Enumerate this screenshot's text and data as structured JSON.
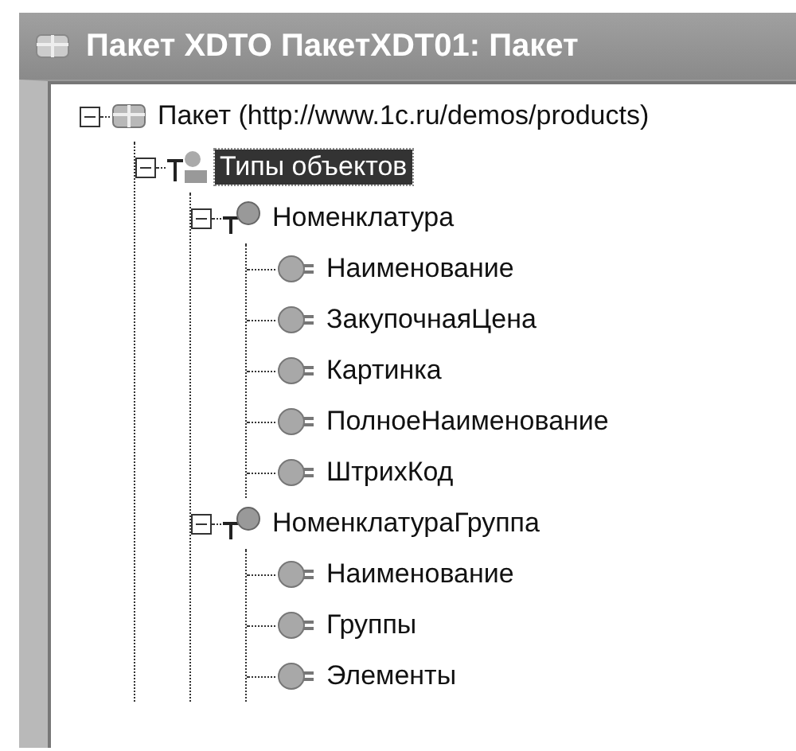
{
  "window": {
    "title": "Пакет XDTO ПакетXDT01: Пакет"
  },
  "tree": {
    "nodes": [
      {
        "label": "Пакет (http://www.1c.ru/demos/products)",
        "kind": "package",
        "expanded": true,
        "selected": false,
        "children": [
          {
            "label": "Типы объектов",
            "kind": "folder",
            "expanded": true,
            "selected": true,
            "children": [
              {
                "label": "Номенклатура",
                "kind": "type",
                "expanded": true,
                "selected": false,
                "children": [
                  {
                    "label": "Наименование",
                    "kind": "property",
                    "selected": false
                  },
                  {
                    "label": "ЗакупочнаяЦена",
                    "kind": "property",
                    "selected": false
                  },
                  {
                    "label": "Картинка",
                    "kind": "property",
                    "selected": false
                  },
                  {
                    "label": "ПолноеНаименование",
                    "kind": "property",
                    "selected": false
                  },
                  {
                    "label": "ШтрихКод",
                    "kind": "property",
                    "selected": false
                  }
                ]
              },
              {
                "label": "НоменклатураГруппа",
                "kind": "type",
                "expanded": true,
                "selected": false,
                "children": [
                  {
                    "label": "Наименование",
                    "kind": "property",
                    "selected": false
                  },
                  {
                    "label": "Группы",
                    "kind": "property",
                    "selected": false
                  },
                  {
                    "label": "Элементы",
                    "kind": "property",
                    "selected": false
                  }
                ]
              }
            ]
          }
        ]
      }
    ]
  }
}
